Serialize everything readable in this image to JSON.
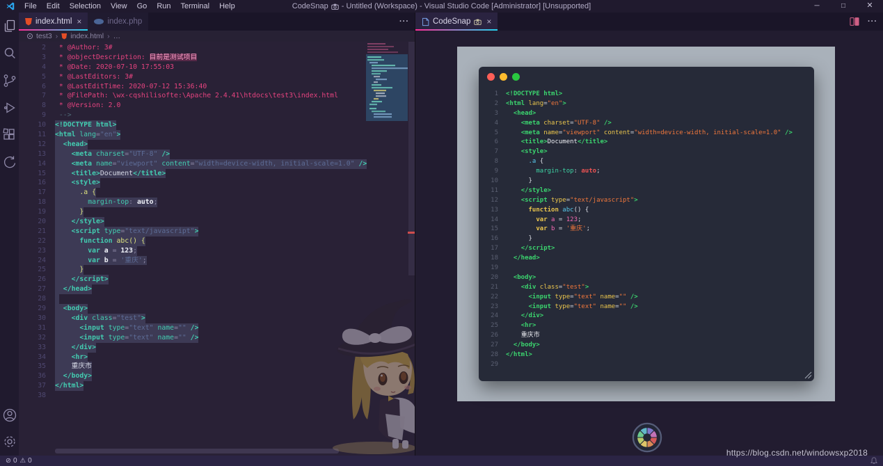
{
  "colors": {
    "tab_accent_left": "#ff2e97",
    "tab_accent_right": "#22d3ee",
    "snapshot_background": "#a9b1ba",
    "window_dots": [
      "#ff5f57",
      "#febc2e",
      "#2ac840"
    ],
    "aperture_blades": [
      "#d45a5a",
      "#d98a56",
      "#dec468",
      "#b9c96a",
      "#6cc98f",
      "#62b9c9",
      "#7e78cc",
      "#c273b8"
    ]
  },
  "title_bar": {
    "menus": [
      "File",
      "Edit",
      "Selection",
      "View",
      "Go",
      "Run",
      "Terminal",
      "Help"
    ],
    "app_name": "CodeSnap",
    "title_rest": "- Untitled (Workspace) - Visual Studio Code [Administrator] [Unsupported]",
    "window_controls": [
      "minimize",
      "maximize",
      "close"
    ]
  },
  "activity_bar": {
    "top_icons": [
      "explorer",
      "search",
      "source-control",
      "run-debug",
      "extensions",
      "back-navigation"
    ],
    "bottom_icons": [
      "account",
      "settings"
    ]
  },
  "left_group": {
    "tabs": [
      {
        "label": "index.html",
        "icon": "html-file",
        "active": true
      },
      {
        "label": "index.php",
        "icon": "php-file",
        "active": false
      }
    ],
    "breadcrumb": {
      "items": [
        "test3",
        "index.html",
        "…"
      ],
      "separator": "›"
    }
  },
  "right_group": {
    "tab": {
      "label": "CodeSnap",
      "icon": "file",
      "badge": "camera"
    }
  },
  "code": {
    "selection": {
      "from": 10,
      "to": 37
    },
    "comment_lines": [
      {
        "n": 2,
        "t": [
          [
            "cm",
            " * @Author: 3#"
          ]
        ]
      },
      {
        "n": 3,
        "t": [
          [
            "cm",
            " * @objectDescription: "
          ],
          [
            "cmzh",
            "目前是测试项目"
          ]
        ]
      },
      {
        "n": 4,
        "t": [
          [
            "cm",
            " * @Date: 2020-07-10 17:55:03"
          ]
        ]
      },
      {
        "n": 5,
        "t": [
          [
            "cm",
            " * @LastEditors: 3#"
          ]
        ]
      },
      {
        "n": 6,
        "t": [
          [
            "cm",
            " * @LastEditTime: 2020-07-12 15:36:40"
          ]
        ]
      },
      {
        "n": 7,
        "t": [
          [
            "cm",
            " * @FilePath: \\wx-cqshilisofte:\\Apache 2.4.41\\htdocs\\test3\\index.html"
          ]
        ]
      },
      {
        "n": 8,
        "t": [
          [
            "cm",
            " * @Version: 2.0"
          ]
        ]
      },
      {
        "n": 9,
        "t": [
          [
            "dim",
            " -->"
          ]
        ]
      }
    ],
    "lines": [
      {
        "n": 10,
        "t": [
          [
            "tg",
            "<!DOCTYPE "
          ],
          [
            "tgb",
            "html"
          ],
          [
            "tg",
            ">"
          ]
        ]
      },
      {
        "n": 11,
        "t": [
          [
            "tg",
            "<html "
          ],
          [
            "at",
            "lang"
          ],
          [
            "eq",
            "="
          ],
          [
            "st",
            "\"en\""
          ],
          [
            "tg",
            ">"
          ]
        ]
      },
      {
        "n": 12,
        "t": [
          [
            "tx",
            "  "
          ],
          [
            "tg",
            "<head>"
          ]
        ]
      },
      {
        "n": 13,
        "t": [
          [
            "tx",
            "    "
          ],
          [
            "tg",
            "<meta "
          ],
          [
            "at",
            "charset"
          ],
          [
            "eq",
            "="
          ],
          [
            "st",
            "\"UTF-8\""
          ],
          [
            "tg",
            " />"
          ]
        ]
      },
      {
        "n": 14,
        "t": [
          [
            "tx",
            "    "
          ],
          [
            "tg",
            "<meta "
          ],
          [
            "at",
            "name"
          ],
          [
            "eq",
            "="
          ],
          [
            "st",
            "\"viewport\""
          ],
          [
            "at",
            " content"
          ],
          [
            "eq",
            "="
          ],
          [
            "st",
            "\"width=device-width, initial-scale=1.0\""
          ],
          [
            "tg",
            " />"
          ]
        ]
      },
      {
        "n": 15,
        "t": [
          [
            "tx",
            "    "
          ],
          [
            "tg",
            "<title>"
          ],
          [
            "tx",
            "Document"
          ],
          [
            "tg",
            "</title>"
          ]
        ]
      },
      {
        "n": 16,
        "t": [
          [
            "tx",
            "    "
          ],
          [
            "tg",
            "<style>"
          ]
        ]
      },
      {
        "n": 17,
        "t": [
          [
            "tx",
            "      "
          ],
          [
            "fn",
            ".a"
          ],
          [
            "pn",
            " {"
          ]
        ]
      },
      {
        "n": 18,
        "t": [
          [
            "tx",
            "        "
          ],
          [
            "pr",
            "margin-top"
          ],
          [
            "eq",
            ": "
          ],
          [
            "vl",
            "auto"
          ],
          [
            "eq",
            ";"
          ]
        ]
      },
      {
        "n": 19,
        "t": [
          [
            "tx",
            "      "
          ],
          [
            "pn",
            "}"
          ]
        ]
      },
      {
        "n": 20,
        "t": [
          [
            "tx",
            "    "
          ],
          [
            "tg",
            "</style>"
          ]
        ]
      },
      {
        "n": 21,
        "t": [
          [
            "tx",
            "    "
          ],
          [
            "tg",
            "<script "
          ],
          [
            "at",
            "type"
          ],
          [
            "eq",
            "="
          ],
          [
            "st",
            "\"text/javascript\""
          ],
          [
            "tg",
            ">"
          ]
        ]
      },
      {
        "n": 22,
        "t": [
          [
            "tx",
            "      "
          ],
          [
            "kw",
            "function "
          ],
          [
            "fn",
            "abc"
          ],
          [
            "pn",
            "() {"
          ]
        ]
      },
      {
        "n": 23,
        "t": [
          [
            "tx",
            "        "
          ],
          [
            "kw",
            "var "
          ],
          [
            "vr",
            "a"
          ],
          [
            "eq",
            " = "
          ],
          [
            "nm",
            "123"
          ],
          [
            "eq",
            ";"
          ]
        ]
      },
      {
        "n": 24,
        "t": [
          [
            "tx",
            "        "
          ],
          [
            "kw",
            "var "
          ],
          [
            "vr",
            "b"
          ],
          [
            "eq",
            " = "
          ],
          [
            "st",
            "'重庆'"
          ],
          [
            "eq",
            ";"
          ]
        ]
      },
      {
        "n": 25,
        "t": [
          [
            "tx",
            "      "
          ],
          [
            "pn",
            "}"
          ]
        ]
      },
      {
        "n": 26,
        "t": [
          [
            "tx",
            "    "
          ],
          [
            "tg",
            "</script>"
          ]
        ]
      },
      {
        "n": 27,
        "t": [
          [
            "tx",
            "  "
          ],
          [
            "tg",
            "</head>"
          ]
        ]
      },
      {
        "n": 28,
        "t": []
      },
      {
        "n": 29,
        "t": [
          [
            "tx",
            "  "
          ],
          [
            "tg",
            "<body>"
          ]
        ]
      },
      {
        "n": 30,
        "t": [
          [
            "tx",
            "    "
          ],
          [
            "tg",
            "<div "
          ],
          [
            "at",
            "class"
          ],
          [
            "eq",
            "="
          ],
          [
            "st",
            "\"test\""
          ],
          [
            "tg",
            ">"
          ]
        ]
      },
      {
        "n": 31,
        "t": [
          [
            "tx",
            "      "
          ],
          [
            "tg",
            "<input "
          ],
          [
            "at",
            "type"
          ],
          [
            "eq",
            "="
          ],
          [
            "st",
            "\"text\""
          ],
          [
            "at",
            " name"
          ],
          [
            "eq",
            "="
          ],
          [
            "st",
            "\"\""
          ],
          [
            "tg",
            " />"
          ]
        ]
      },
      {
        "n": 32,
        "t": [
          [
            "tx",
            "      "
          ],
          [
            "tg",
            "<input "
          ],
          [
            "at",
            "type"
          ],
          [
            "eq",
            "="
          ],
          [
            "st",
            "\"text\""
          ],
          [
            "at",
            " name"
          ],
          [
            "eq",
            "="
          ],
          [
            "st",
            "\"\""
          ],
          [
            "tg",
            " />"
          ]
        ]
      },
      {
        "n": 33,
        "t": [
          [
            "tx",
            "    "
          ],
          [
            "tg",
            "</div>"
          ]
        ]
      },
      {
        "n": 34,
        "t": [
          [
            "tx",
            "    "
          ],
          [
            "tg",
            "<hr>"
          ]
        ]
      },
      {
        "n": 35,
        "t": [
          [
            "tx",
            "    "
          ],
          [
            "tx",
            "重庆市"
          ]
        ]
      },
      {
        "n": 36,
        "t": [
          [
            "tx",
            "  "
          ],
          [
            "tg",
            "</body>"
          ]
        ]
      },
      {
        "n": 37,
        "t": [
          [
            "tg",
            "</html>"
          ]
        ]
      },
      {
        "n": 38,
        "t": []
      }
    ]
  },
  "snapshot_panel": {
    "first_line": 1,
    "last_line": 29
  },
  "status_bar": {
    "errors": "0",
    "warnings": "0"
  },
  "watermark": {
    "text": "https://blog.csdn.net/windowsxp2018"
  }
}
